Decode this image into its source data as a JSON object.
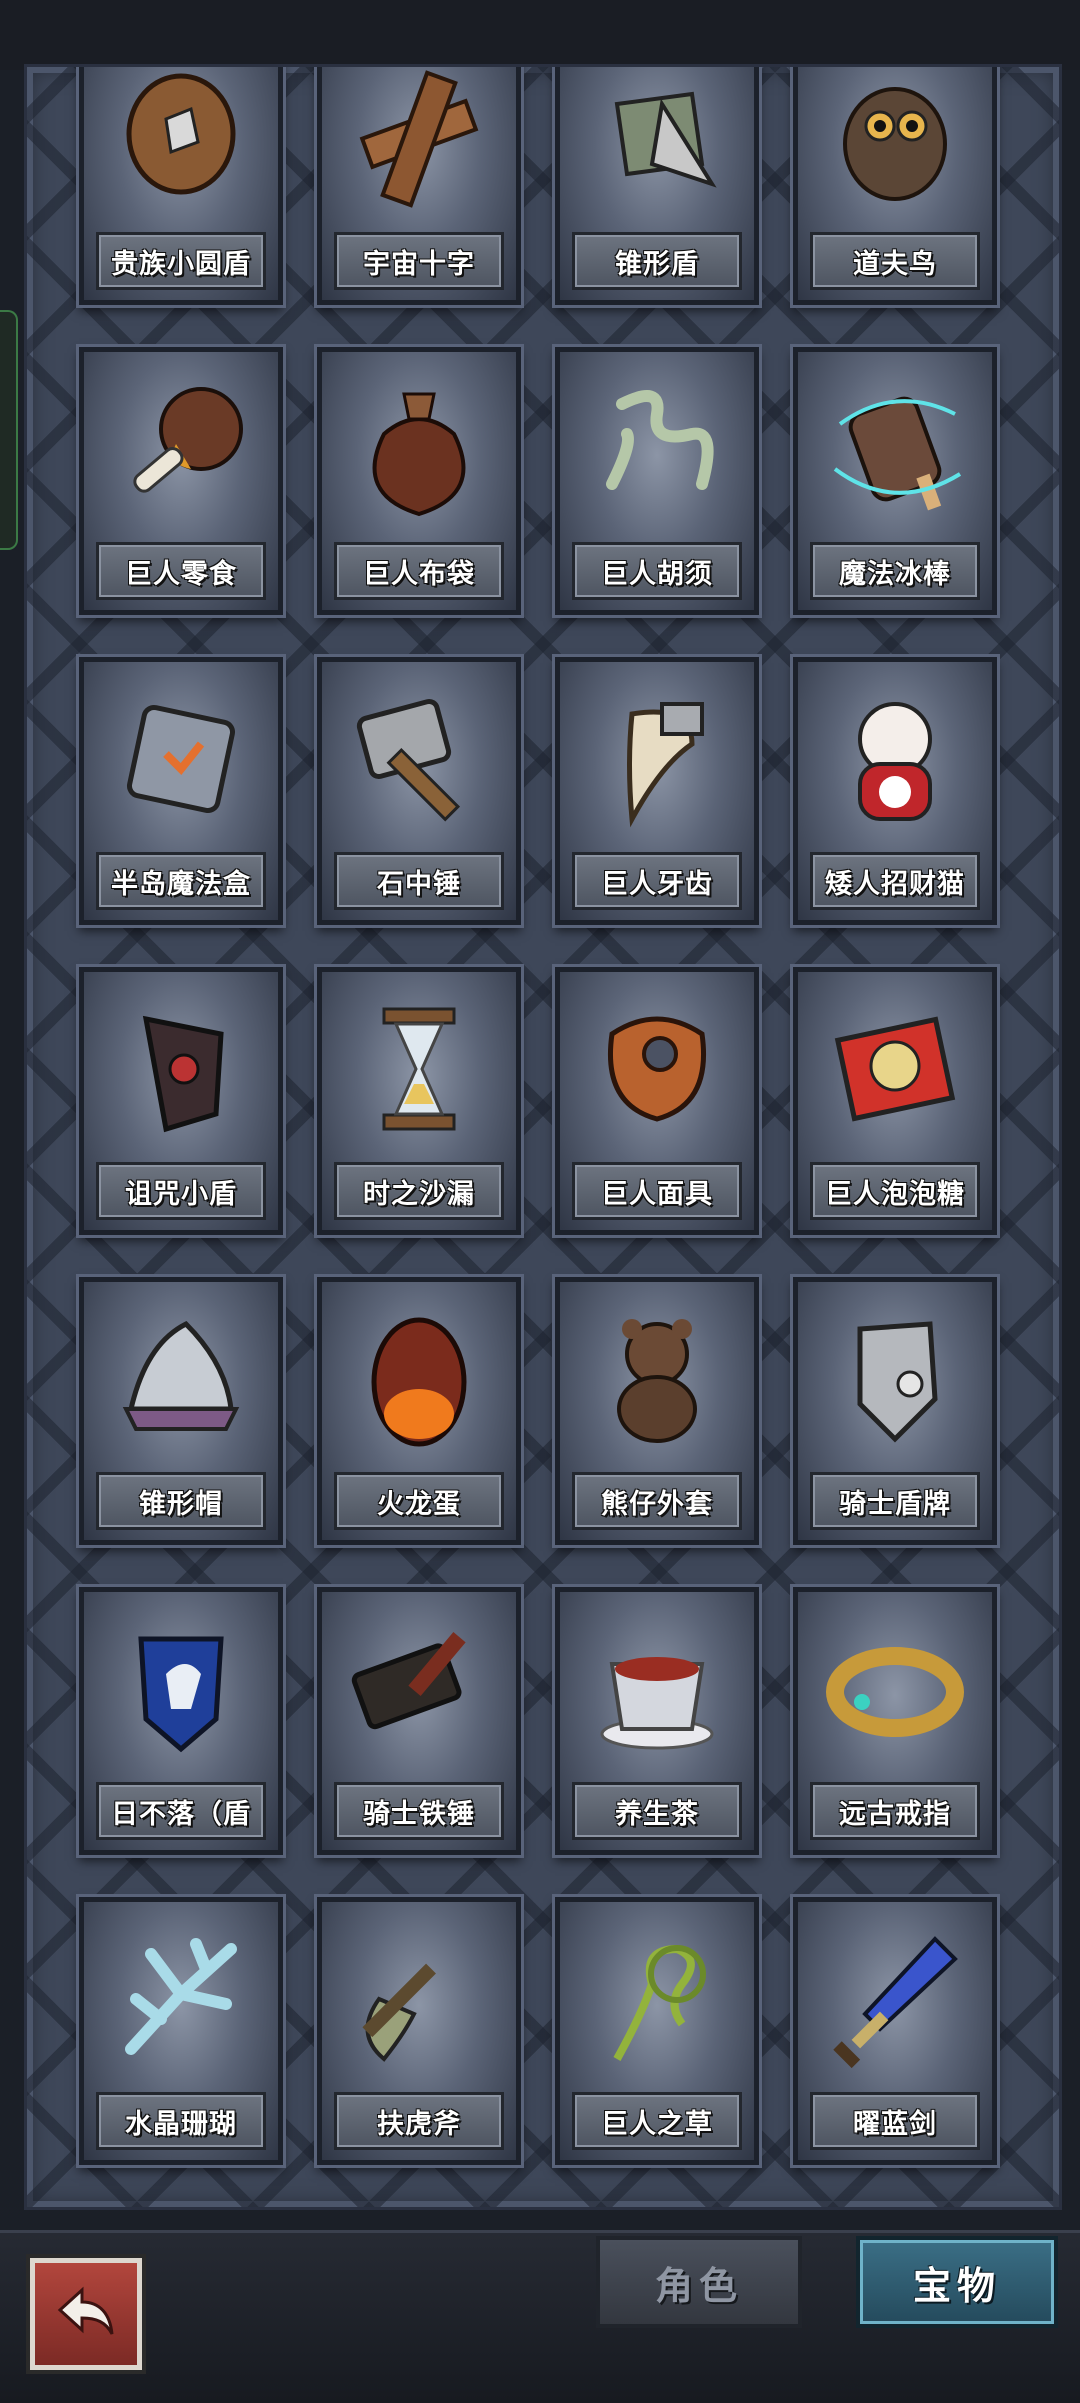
{
  "colors": {
    "frame": "#3e4759",
    "card_plate": "#5c6370",
    "tab_active": "#2e5a6f",
    "back_button": "#a03a33"
  },
  "items": [
    {
      "label": "贵族小圆盾",
      "icon": "round-shield-icon"
    },
    {
      "label": "宇宙十字",
      "icon": "wooden-cross-icon"
    },
    {
      "label": "锥形盾",
      "icon": "cone-shield-icon"
    },
    {
      "label": "道夫鸟",
      "icon": "owl-bird-icon"
    },
    {
      "label": "巨人零食",
      "icon": "meat-drumstick-icon"
    },
    {
      "label": "巨人布袋",
      "icon": "cloth-sack-icon"
    },
    {
      "label": "巨人胡须",
      "icon": "beard-hair-icon"
    },
    {
      "label": "魔法冰棒",
      "icon": "magic-popsicle-icon"
    },
    {
      "label": "半岛魔法盒",
      "icon": "magic-cube-icon"
    },
    {
      "label": "石中锤",
      "icon": "stone-hammer-icon"
    },
    {
      "label": "巨人牙齿",
      "icon": "giant-tooth-icon"
    },
    {
      "label": "矮人招财猫",
      "icon": "lucky-cat-icon"
    },
    {
      "label": "诅咒小盾",
      "icon": "cursed-shield-icon"
    },
    {
      "label": "时之沙漏",
      "icon": "hourglass-icon"
    },
    {
      "label": "巨人面具",
      "icon": "giant-mask-icon"
    },
    {
      "label": "巨人泡泡糖",
      "icon": "bubblegum-pack-icon"
    },
    {
      "label": "锥形帽",
      "icon": "cone-helmet-icon"
    },
    {
      "label": "火龙蛋",
      "icon": "fire-dragon-egg-icon"
    },
    {
      "label": "熊仔外套",
      "icon": "teddy-bear-icon"
    },
    {
      "label": "骑士盾牌",
      "icon": "knight-shield-icon"
    },
    {
      "label": "日不落（盾",
      "icon": "lion-crest-shield-icon"
    },
    {
      "label": "骑士铁锤",
      "icon": "knight-hammer-icon"
    },
    {
      "label": "养生茶",
      "icon": "tea-cup-icon"
    },
    {
      "label": "远古戒指",
      "icon": "ancient-ring-icon"
    },
    {
      "label": "水晶珊瑚",
      "icon": "crystal-coral-icon"
    },
    {
      "label": "扶虎斧",
      "icon": "tiger-axe-icon"
    },
    {
      "label": "巨人之草",
      "icon": "giant-grass-icon"
    },
    {
      "label": "曜蓝剑",
      "icon": "blue-sword-icon"
    }
  ],
  "tabs": {
    "role": "角色",
    "treasure": "宝物"
  },
  "back_icon": "return-arrow-icon"
}
